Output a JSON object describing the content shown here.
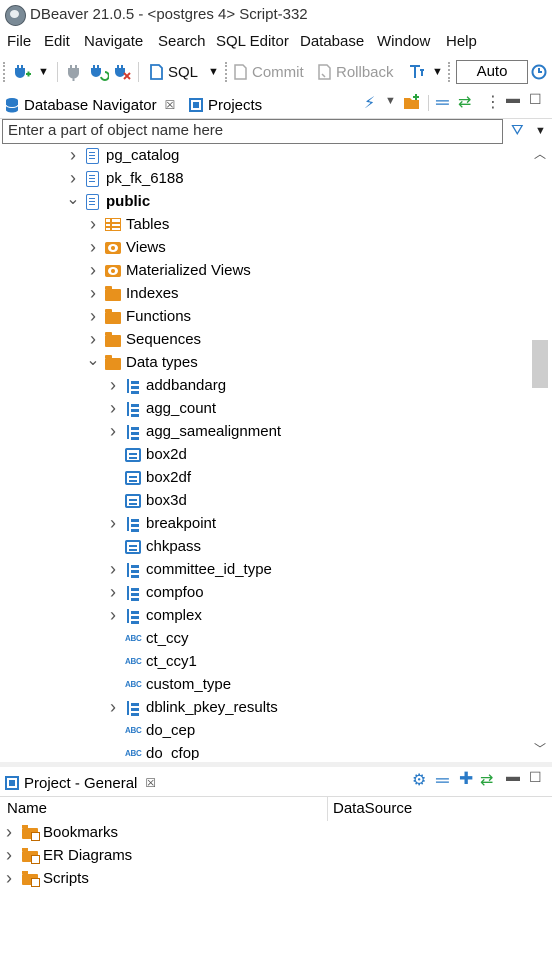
{
  "window": {
    "title": "DBeaver 21.0.5 - <postgres 4> Script-332"
  },
  "menu": [
    "File",
    "Edit",
    "Navigate",
    "Search",
    "SQL Editor",
    "Database",
    "Window",
    "Help"
  ],
  "toolbar": {
    "sql_label": "SQL",
    "commit_label": "Commit",
    "rollback_label": "Rollback",
    "transaction_mode": "Auto"
  },
  "navigator": {
    "tab_label": "Database Navigator",
    "projects_tab_label": "Projects",
    "filter_placeholder": "Enter a part of object name here",
    "tree": [
      {
        "label": "pg_catalog",
        "icon": "schema-icon",
        "expanded": false
      },
      {
        "label": "pk_fk_6188",
        "icon": "schema-icon",
        "expanded": false
      },
      {
        "label": "public",
        "icon": "schema-icon",
        "expanded": true,
        "bold": true
      },
      {
        "label": "Tables",
        "icon": "tables-folder-icon",
        "expanded": false
      },
      {
        "label": "Views",
        "icon": "views-folder-icon",
        "expanded": false
      },
      {
        "label": "Materialized Views",
        "icon": "views-folder-icon",
        "expanded": false
      },
      {
        "label": "Indexes",
        "icon": "folder-icon",
        "expanded": false
      },
      {
        "label": "Functions",
        "icon": "folder-icon",
        "expanded": false
      },
      {
        "label": "Sequences",
        "icon": "folder-icon",
        "expanded": false
      },
      {
        "label": "Data types",
        "icon": "folder-icon",
        "expanded": true
      },
      {
        "label": "addbandarg",
        "icon": "composite-type-icon",
        "expanded": false
      },
      {
        "label": "agg_count",
        "icon": "composite-type-icon",
        "expanded": false
      },
      {
        "label": "agg_samealignment",
        "icon": "composite-type-icon",
        "expanded": false
      },
      {
        "label": "box2d",
        "icon": "base-type-icon"
      },
      {
        "label": "box2df",
        "icon": "base-type-icon"
      },
      {
        "label": "box3d",
        "icon": "base-type-icon"
      },
      {
        "label": "breakpoint",
        "icon": "composite-type-icon",
        "expanded": false
      },
      {
        "label": "chkpass",
        "icon": "base-type-icon"
      },
      {
        "label": "committee_id_type",
        "icon": "composite-type-icon",
        "expanded": false
      },
      {
        "label": "compfoo",
        "icon": "composite-type-icon",
        "expanded": false
      },
      {
        "label": "complex",
        "icon": "composite-type-icon",
        "expanded": false
      },
      {
        "label": "ct_ccy",
        "icon": "enum-type-icon"
      },
      {
        "label": "ct_ccy1",
        "icon": "enum-type-icon"
      },
      {
        "label": "custom_type",
        "icon": "enum-type-icon"
      },
      {
        "label": "dblink_pkey_results",
        "icon": "composite-type-icon",
        "expanded": false
      },
      {
        "label": "do_cep",
        "icon": "enum-type-icon"
      },
      {
        "label": "do_cfop",
        "icon": "enum-type-icon"
      }
    ]
  },
  "project_panel": {
    "tab_label": "Project - General",
    "columns": [
      "Name",
      "DataSource"
    ],
    "items": [
      {
        "label": "Bookmarks",
        "icon": "bookmarks-folder-icon"
      },
      {
        "label": "ER Diagrams",
        "icon": "er-diagrams-folder-icon"
      },
      {
        "label": "Scripts",
        "icon": "scripts-folder-icon"
      }
    ]
  },
  "icons": {
    "enum_glyph": "ABC"
  }
}
